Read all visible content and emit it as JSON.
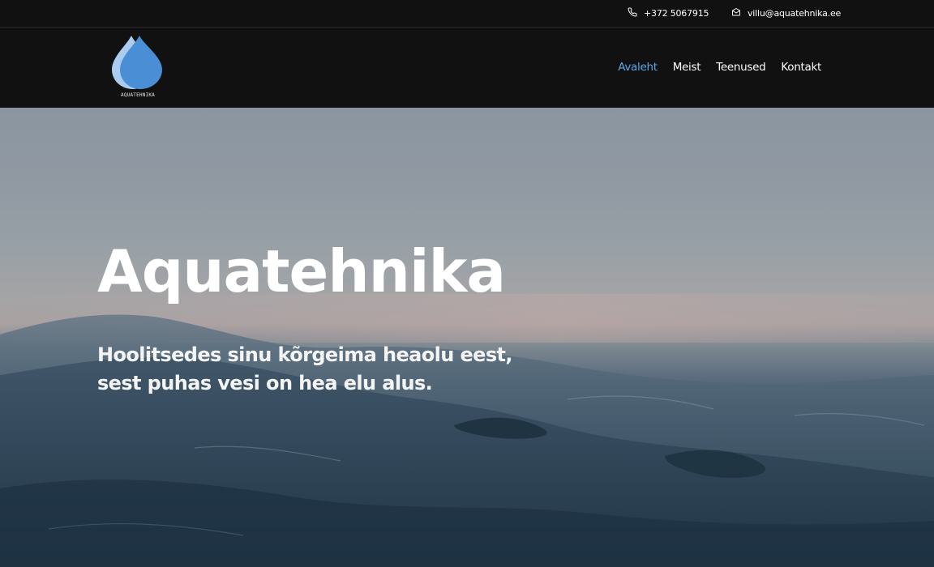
{
  "topbar": {
    "phone": {
      "icon": "phone-icon",
      "text": "+372 5067915"
    },
    "email": {
      "icon": "mail-icon",
      "text": "villu@aquatehnika.ee"
    }
  },
  "header": {
    "logo_text": "AQUATEHNIKA",
    "nav": [
      {
        "label": "Avaleht",
        "active": true
      },
      {
        "label": "Meist",
        "active": false
      },
      {
        "label": "Teenused",
        "active": false
      },
      {
        "label": "Kontakt",
        "active": false
      }
    ]
  },
  "hero": {
    "title": "Aquatehnika",
    "subtitle": "Hoolitsedes sinu kõrgeima heaolu eest, sest puhas vesi on hea elu alus."
  },
  "colors": {
    "background": "#111111",
    "accent": "#5aa7e6",
    "logo_drop_light": "#a9ccef",
    "logo_drop_dark": "#4a8fd6"
  }
}
